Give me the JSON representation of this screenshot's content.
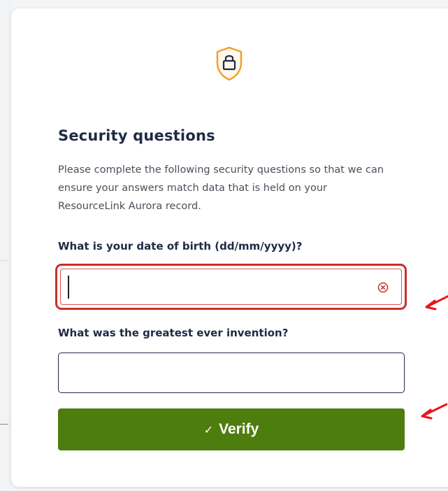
{
  "page": {
    "title": "Security questions",
    "description": "Please complete the following security questions so that we can ensure your answers match data that is held on your ResourceLink Aurora record."
  },
  "questions": [
    {
      "label": "What is your date of birth (dd/mm/yyyy)?",
      "value": "",
      "state": "error"
    },
    {
      "label": "What was the greatest ever invention?",
      "value": ""
    }
  ],
  "verify_button": {
    "icon": "check-icon",
    "label": "Verify"
  },
  "icons": {
    "header": "shield-lock-icon",
    "clear": "clear-circle-x-icon"
  },
  "colors": {
    "accent_orange": "#f0a030",
    "primary_green": "#4e7d0f",
    "error_red": "#c9302c",
    "heading_navy": "#1f2a44"
  }
}
